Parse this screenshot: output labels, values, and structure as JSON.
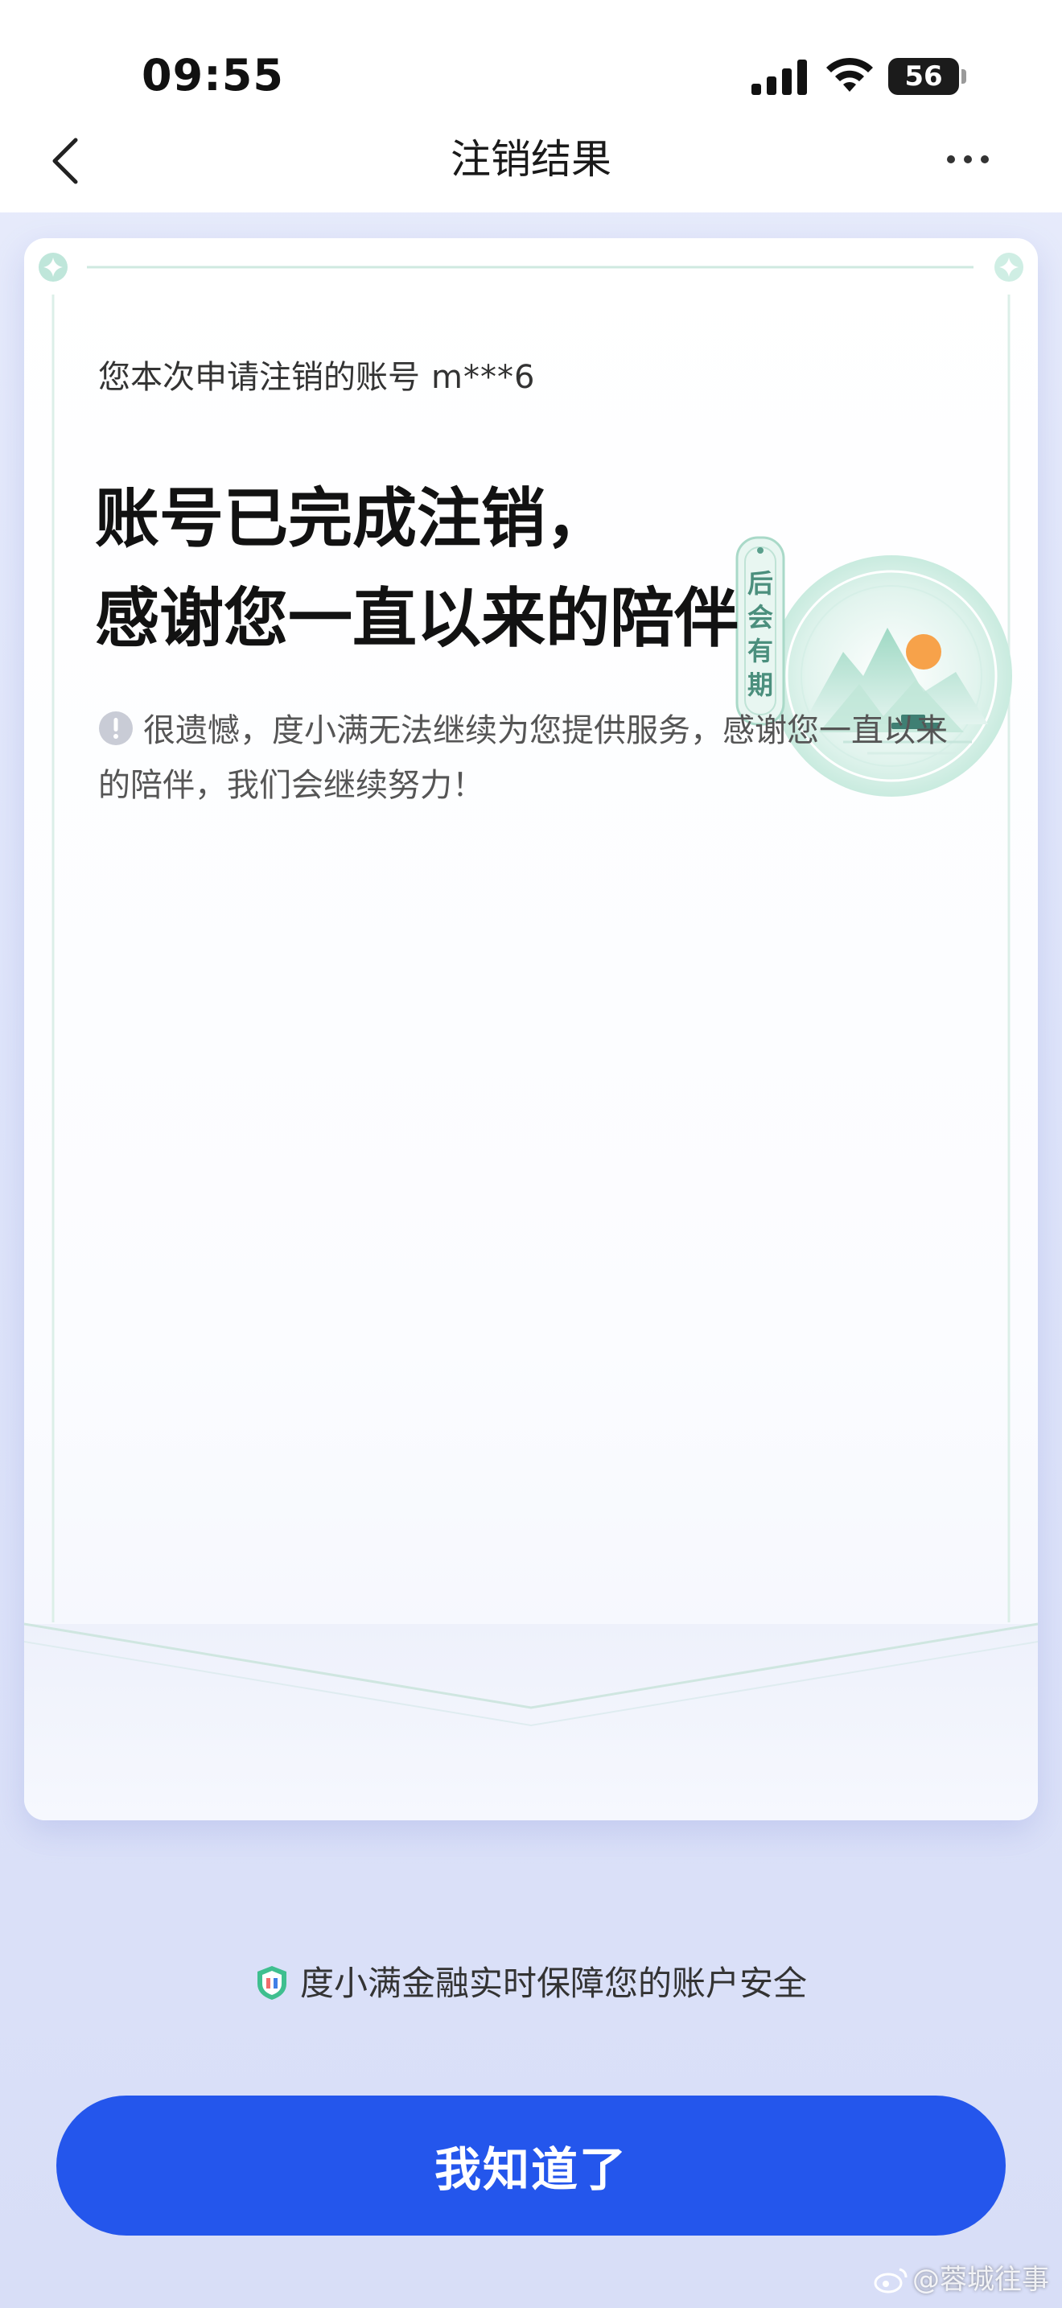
{
  "status_bar": {
    "time": "09:55",
    "battery": "56",
    "signal_icon": "cellular-signal-icon",
    "wifi_icon": "wifi-icon"
  },
  "nav": {
    "title": "注销结果",
    "back_icon": "chevron-left-icon",
    "more_icon": "more-dots-icon"
  },
  "card": {
    "account_label": "您本次申请注销的账号",
    "account_value": "m***6",
    "headline_line1": "账号已完成注销，",
    "headline_line2": "感谢您一直以来的陪伴",
    "notice_text": "很遗憾，度小满无法继续为您提供服务，感谢您一直以来的陪伴，我们会继续努力！",
    "emblem_text": "后会有期"
  },
  "footer": {
    "security_text": "度小满金融实时保障您的账户安全",
    "button_label": "我知道了"
  },
  "watermark": {
    "text": "@蓉城往事"
  },
  "colors": {
    "primary": "#2456ec",
    "background": "#dfe5fa",
    "accent_green": "#8fd1bb",
    "sun": "#f7a24a"
  }
}
